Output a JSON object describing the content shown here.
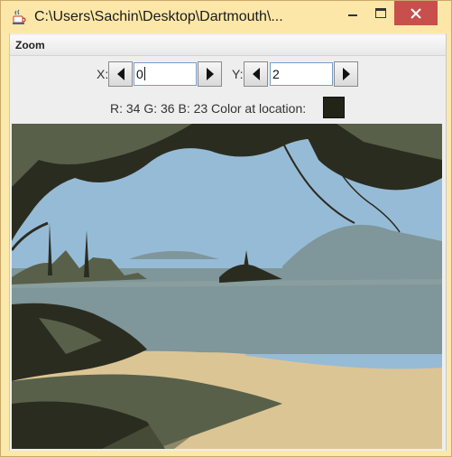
{
  "window": {
    "title": "C:\\Users\\Sachin\\Desktop\\Dartmouth\\..."
  },
  "menubar": {
    "items": [
      {
        "label": "Zoom"
      }
    ]
  },
  "controls": {
    "x_label": "X:",
    "x_value": "0",
    "y_label": "Y:",
    "y_value": "2"
  },
  "color_info": {
    "text": "R: 34  G: 36  B: 23  Color at location:",
    "swatch_color": "#222417"
  },
  "colors": {
    "sky": "#96bbd6",
    "water": "#7f969a",
    "sand": "#dcc594",
    "dark_foliage": "#2b2c20",
    "mid_foliage": "#58604a",
    "close_button": "#c7504c",
    "titlebar": "#fde7a8"
  },
  "icons": {
    "app": "java-coffee-cup-icon",
    "decrement": "left-arrow-icon",
    "increment": "right-arrow-icon"
  }
}
